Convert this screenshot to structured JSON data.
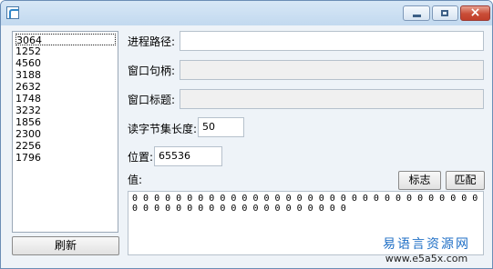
{
  "process_list": [
    "3064",
    "1252",
    "4560",
    "3188",
    "2632",
    "1748",
    "3232",
    "1856",
    "2300",
    "2256",
    "1796"
  ],
  "selected_index": 0,
  "refresh_label": "刷新",
  "fields": {
    "process_path_label": "进程路径:",
    "process_path_value": "",
    "window_handle_label": "窗口句柄:",
    "window_handle_value": "",
    "window_title_label": "窗口标题:",
    "window_title_value": "",
    "read_length_label": "读字节集长度:",
    "read_length_value": "50",
    "position_label": "位置:",
    "position_value": "65536",
    "value_label": "值:"
  },
  "buttons": {
    "flag": "标志",
    "match": "匹配"
  },
  "value_text": "0 0 0 0 0 0 0 0 0 0 0 0 0 0 0 0 0 0 0 0 0 0 0 0 0 0 0 0 0 0 0 0 0 0 0 0 0 0 0 0 0 0 0 0 0 0 0 0 0 0 0 0",
  "watermark": {
    "line1": "易语言资源网",
    "line2": "www.e5a5x.com"
  }
}
